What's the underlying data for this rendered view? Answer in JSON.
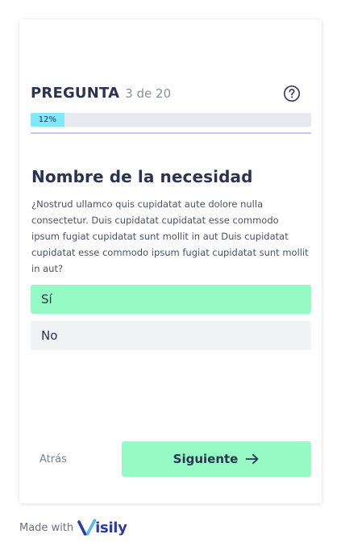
{
  "question": {
    "word": "PREGUNTA",
    "counter": "3 de 20"
  },
  "progress": {
    "percent": 12,
    "label": "12%"
  },
  "content": {
    "title": "Nombre de la necesidad",
    "description": "¿Nostrud ullamco quis cupidatat aute dolore nulla consectetur. Duis cupidatat cupidatat esse commodo ipsum fugiat cupidatat sunt mollit in aut Duis cupidatat cupidatat esse commodo ipsum fugiat cupidatat sunt mollit in aut?"
  },
  "options": [
    {
      "label": "Sí",
      "selected": true
    },
    {
      "label": "No",
      "selected": false
    }
  ],
  "navigation": {
    "back_label": "Atrás",
    "next_label": "Siguiente"
  },
  "footer": {
    "made_with": "Made with",
    "logo_text": "isily"
  },
  "icons": {
    "help": "question-circle-icon",
    "next": "arrow-right-icon",
    "logo": "visily-logo"
  },
  "colors": {
    "accent": "#95fac3",
    "progress_fill": "#7fe9f5",
    "progress_track": "#e7e9ee",
    "underline": "#c9c6f5",
    "text_dark": "#2b3352",
    "logo": "#2b3aa8"
  }
}
